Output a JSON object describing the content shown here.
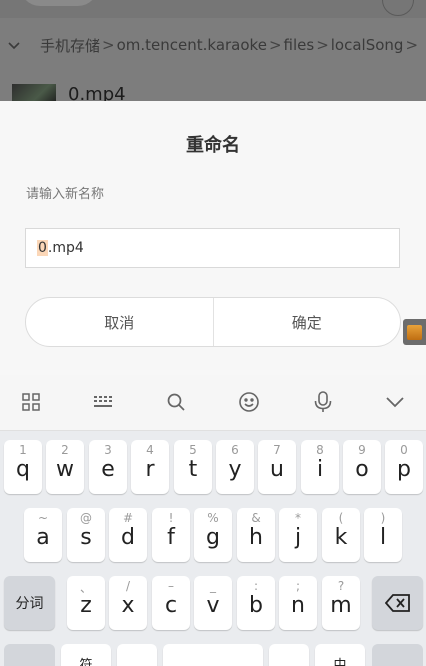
{
  "background": {
    "breadcrumb": [
      "手机存储",
      "om.tencent.karaoke",
      "files",
      "localSong"
    ],
    "breadcrumb_separator": ">",
    "file_name": "0.mp4"
  },
  "dialog": {
    "title": "重命名",
    "hint": "请输入新名称",
    "input_selected": "0",
    "input_rest": ".mp4",
    "cancel_label": "取消",
    "confirm_label": "确定"
  },
  "keyboard": {
    "toolbar_icons": [
      "grid-menu-icon",
      "keyboard-icon",
      "search-icon",
      "emoji-icon",
      "microphone-icon",
      "chevron-down-icon"
    ],
    "row1": [
      {
        "main": "q",
        "sub": "1"
      },
      {
        "main": "w",
        "sub": "2"
      },
      {
        "main": "e",
        "sub": "3"
      },
      {
        "main": "r",
        "sub": "4"
      },
      {
        "main": "t",
        "sub": "5"
      },
      {
        "main": "y",
        "sub": "6"
      },
      {
        "main": "u",
        "sub": "7"
      },
      {
        "main": "i",
        "sub": "8"
      },
      {
        "main": "o",
        "sub": "9"
      },
      {
        "main": "p",
        "sub": "0"
      }
    ],
    "row2": [
      {
        "main": "a",
        "sub": "~"
      },
      {
        "main": "s",
        "sub": "@"
      },
      {
        "main": "d",
        "sub": "#"
      },
      {
        "main": "f",
        "sub": "!"
      },
      {
        "main": "g",
        "sub": "%"
      },
      {
        "main": "h",
        "sub": "&"
      },
      {
        "main": "j",
        "sub": "*"
      },
      {
        "main": "k",
        "sub": "("
      },
      {
        "main": "l",
        "sub": ")"
      }
    ],
    "row3": [
      {
        "main": "z",
        "sub": "、"
      },
      {
        "main": "x",
        "sub": "/"
      },
      {
        "main": "c",
        "sub": "–"
      },
      {
        "main": "v",
        "sub": "_"
      },
      {
        "main": "b",
        "sub": ":"
      },
      {
        "main": "n",
        "sub": ";"
      },
      {
        "main": "m",
        "sub": "?"
      }
    ],
    "segment_label": "分词",
    "row4_partial": [
      "符",
      "中"
    ]
  }
}
